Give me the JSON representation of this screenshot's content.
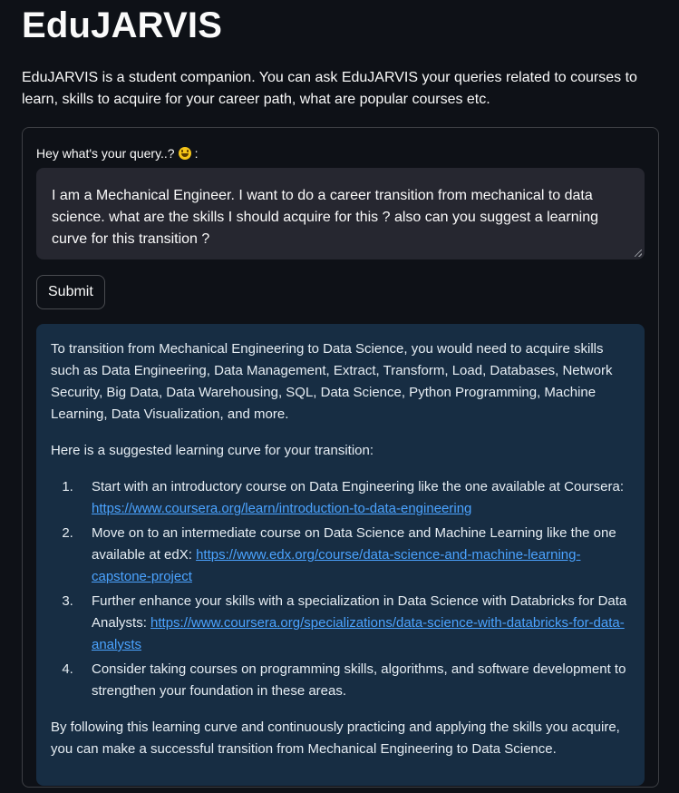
{
  "app": {
    "title": "EduJARVIS",
    "intro": "EduJARVIS is a student companion. You can ask EduJARVIS your queries related to courses to learn, skills to acquire for your career path, what are popular courses etc."
  },
  "form": {
    "label_text": "Hey what's your query..?",
    "label_suffix": " :",
    "label_icon": "grinning-face-emoji",
    "query_value": "I am a Mechanical Engineer. I want to do a career transition from mechanical to data science. what are the skills I should acquire for this ? also can you suggest a learning curve for this transition ?",
    "submit_label": "Submit"
  },
  "response": {
    "intro_paragraph": "To transition from Mechanical Engineering to Data Science, you would need to acquire skills such as Data Engineering, Data Management, Extract, Transform, Load, Databases, Network Security, Big Data, Data Warehousing, SQL, Data Science, Python Programming, Machine Learning, Data Visualization, and more.",
    "lead_in": "Here is a suggested learning curve for your transition:",
    "steps": [
      {
        "text": "Start with an introductory course on Data Engineering like the one available at Coursera: ",
        "link": "https://www.coursera.org/learn/introduction-to-data-engineering"
      },
      {
        "text": "Move on to an intermediate course on Data Science and Machine Learning like the one available at edX: ",
        "link": "https://www.edx.org/course/data-science-and-machine-learning-capstone-project"
      },
      {
        "text": "Further enhance your skills with a specialization in Data Science with Databricks for Data Analysts: ",
        "link": "https://www.coursera.org/specializations/data-science-with-databricks-for-data-analysts"
      },
      {
        "text": "Consider taking courses on programming skills, algorithms, and software development to strengthen your foundation in these areas.",
        "link": ""
      }
    ],
    "closing": "By following this learning curve and continuously practicing and applying the skills you acquire, you can make a successful transition from Mechanical Engineering to Data Science."
  },
  "colors": {
    "background": "#0e1117",
    "input_background": "#262730",
    "response_background": "#172d43",
    "link": "#4ba3ff"
  }
}
